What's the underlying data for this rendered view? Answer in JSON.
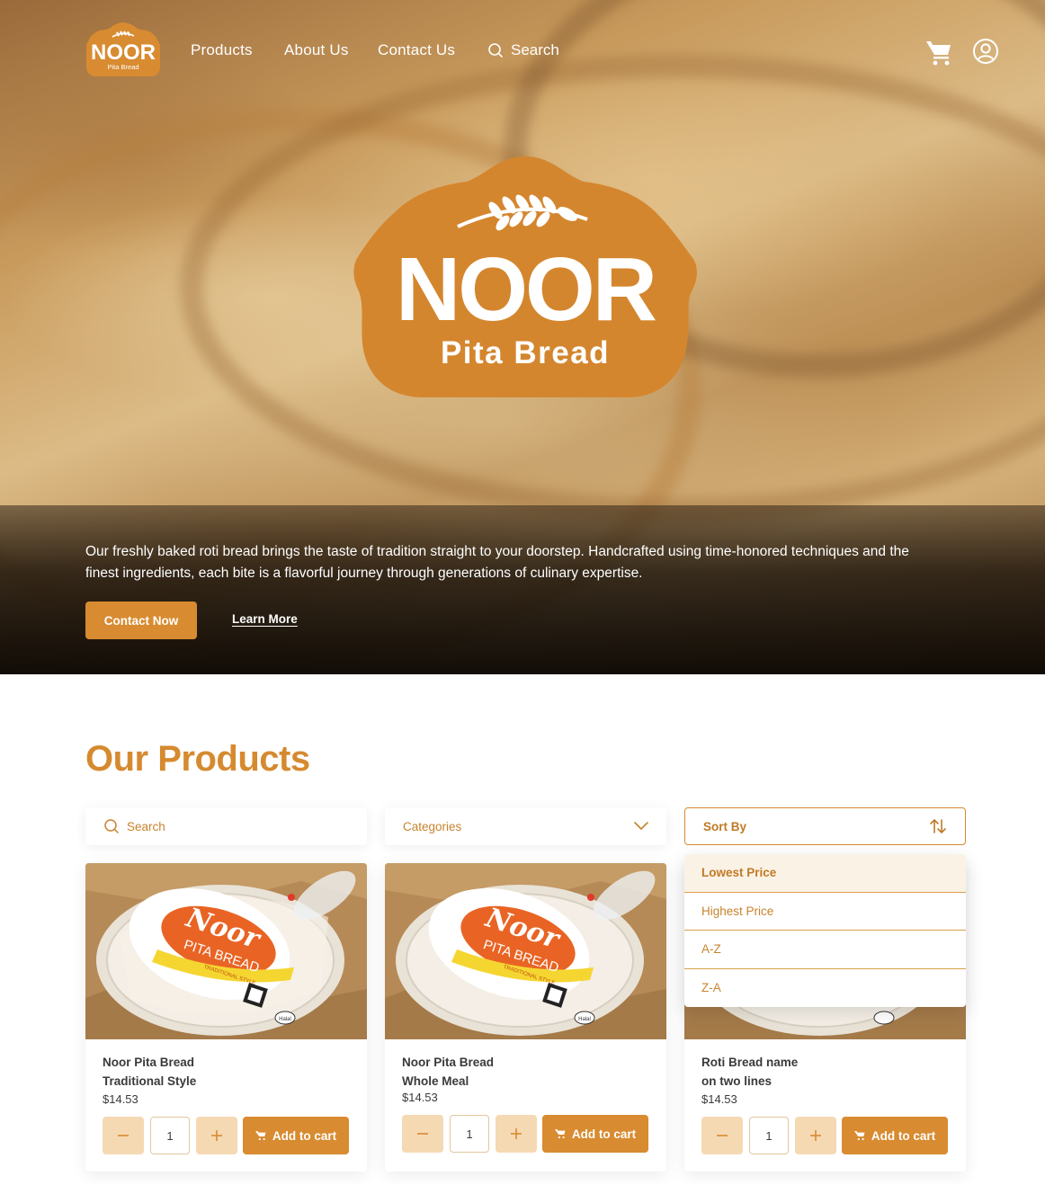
{
  "brand": {
    "name": "NOOR",
    "tagline": "Pita Bread",
    "accent": "#D88B30"
  },
  "nav": {
    "links": [
      "Products",
      "About Us",
      "Contact Us"
    ],
    "search_label": "Search"
  },
  "hero": {
    "description": "Our freshly baked roti bread brings the taste of tradition straight to your doorstep. Handcrafted using time-honored techniques and the finest ingredients, each bite is a flavorful journey through generations of culinary expertise.",
    "primary_button": "Contact Now",
    "secondary_link": "Learn More"
  },
  "products_section": {
    "title": "Our Products",
    "search_placeholder": "Search",
    "categories_label": "Categories",
    "sort_label": "Sort By",
    "sort_options": [
      "Lowest Price",
      "Highest Price",
      "A-Z",
      "Z-A"
    ],
    "sort_selected": "Lowest Price"
  },
  "package_text": {
    "brand": "Noor",
    "product": "PITA BREAD",
    "style": "TRADITIONAL STYLE",
    "badge": "Halal"
  },
  "products": [
    {
      "name_line1": "Noor Pita Bread",
      "name_line2": "Traditional Style",
      "price": "$14.53",
      "quantity": "1",
      "add_label": "Add to cart"
    },
    {
      "name_line1": "Noor Pita Bread",
      "name_line2": "Whole Meal",
      "price": "$14.53",
      "quantity": "1",
      "add_label": "Add to cart"
    },
    {
      "name_line1": "Roti Bread name",
      "name_line2": "on two lines",
      "price": "$14.53",
      "quantity": "1",
      "add_label": "Add to cart"
    }
  ]
}
